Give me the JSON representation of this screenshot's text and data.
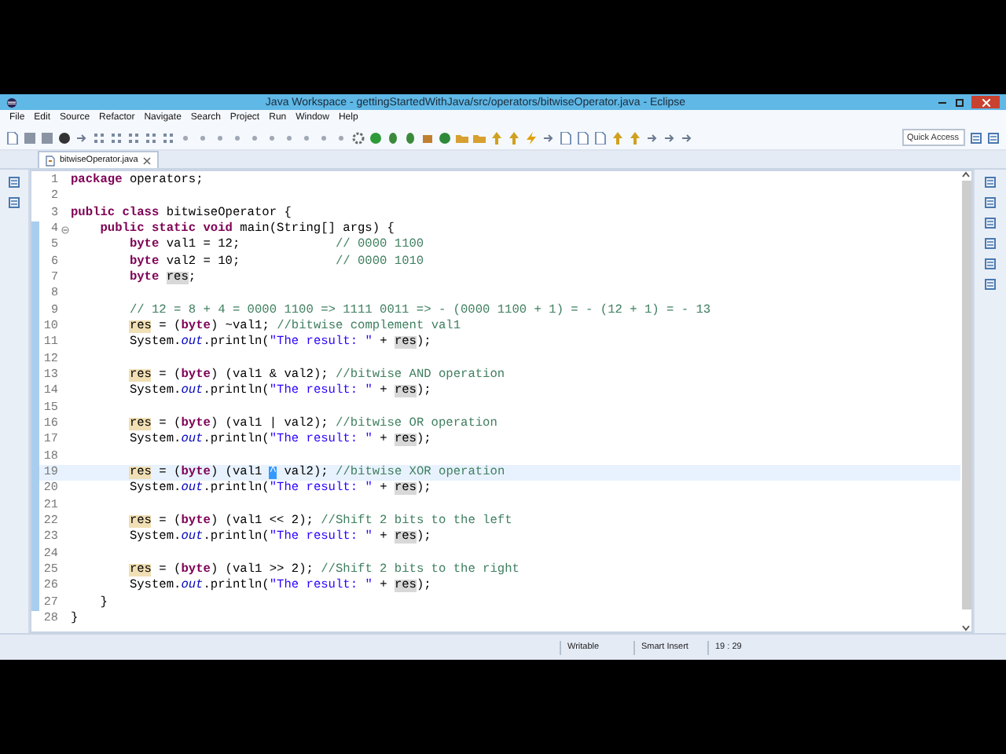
{
  "window": {
    "title": "Java Workspace - gettingStartedWithJava/src/operators/bitwiseOperator.java - Eclipse"
  },
  "menu": [
    "File",
    "Edit",
    "Source",
    "Refactor",
    "Navigate",
    "Search",
    "Project",
    "Run",
    "Window",
    "Help"
  ],
  "toolbar": {
    "quick_access": {
      "placeholder": "Quick Access"
    }
  },
  "editor_tabs": [
    {
      "label": "bitwiseOperator.java",
      "selected": true
    }
  ],
  "editor": {
    "lines": [
      {
        "number": "1",
        "current": false,
        "fold": false,
        "scope": false,
        "tokens": [
          {
            "kind": "keyword",
            "text": "package"
          },
          {
            "kind": "plain",
            "text": " operators;"
          }
        ]
      },
      {
        "number": "2",
        "current": false,
        "fold": false,
        "scope": false
      },
      {
        "number": "3",
        "current": false,
        "fold": false,
        "scope": false,
        "tokens": [
          {
            "kind": "keyword",
            "text": "public class"
          },
          {
            "kind": "plain",
            "text": " bitwiseOperator {"
          }
        ]
      },
      {
        "number": "4",
        "current": false,
        "fold": true,
        "scope": true,
        "tokens": [
          {
            "kind": "keyword",
            "text": "    public static void"
          },
          {
            "kind": "plain",
            "text": " main(String[] args) {"
          }
        ]
      },
      {
        "number": "5",
        "current": false,
        "fold": false,
        "scope": true,
        "tokens": [
          {
            "kind": "keyword",
            "text": "        byte"
          },
          {
            "kind": "plain",
            "text": " val1 = 12;             "
          },
          {
            "kind": "comment",
            "text": "// 0000 1100"
          }
        ]
      },
      {
        "number": "6",
        "current": false,
        "fold": false,
        "scope": true,
        "tokens": [
          {
            "kind": "keyword",
            "text": "        byte"
          },
          {
            "kind": "plain",
            "text": " val2 = 10;             "
          },
          {
            "kind": "comment",
            "text": "// 0000 1010"
          }
        ]
      },
      {
        "number": "7",
        "current": false,
        "fold": false,
        "scope": true,
        "tokens": [
          {
            "kind": "keyword",
            "text": "        byte "
          },
          {
            "kind": "read",
            "text": "res"
          },
          {
            "kind": "plain",
            "text": ";"
          }
        ]
      },
      {
        "number": "8",
        "current": false,
        "fold": false,
        "scope": true
      },
      {
        "number": "9",
        "current": false,
        "fold": false,
        "scope": true,
        "tokens": [
          {
            "kind": "comment",
            "text": "        // 12 = 8 + 4 = 0000 1100 => 1111 0011 => - (0000 1100 + 1) = - (12 + 1) = - 13"
          }
        ]
      },
      {
        "number": "10",
        "current": false,
        "fold": false,
        "scope": true,
        "tokens": [
          {
            "kind": "write",
            "text": "        res"
          },
          {
            "kind": "plain",
            "text": " = ("
          },
          {
            "kind": "keyword",
            "text": "byte"
          },
          {
            "kind": "plain",
            "text": ") ~val1; "
          },
          {
            "kind": "comment",
            "text": "//bitwise complement val1"
          }
        ]
      },
      {
        "number": "11",
        "current": false,
        "fold": false,
        "scope": true,
        "tokens": [
          {
            "kind": "plain",
            "text": "        System."
          },
          {
            "kind": "field",
            "text": "out"
          },
          {
            "kind": "plain",
            "text": ".println("
          },
          {
            "kind": "string",
            "text": "\"The result: \""
          },
          {
            "kind": "plain",
            "text": " + "
          },
          {
            "kind": "read",
            "text": "res"
          },
          {
            "kind": "plain",
            "text": ");"
          }
        ]
      },
      {
        "number": "12",
        "current": false,
        "fold": false,
        "scope": true
      },
      {
        "number": "13",
        "current": false,
        "fold": false,
        "scope": true,
        "tokens": [
          {
            "kind": "write",
            "text": "        res"
          },
          {
            "kind": "plain",
            "text": " = ("
          },
          {
            "kind": "keyword",
            "text": "byte"
          },
          {
            "kind": "plain",
            "text": ") (val1 & val2); "
          },
          {
            "kind": "comment",
            "text": "//bitwise AND operation"
          }
        ]
      },
      {
        "number": "14",
        "current": false,
        "fold": false,
        "scope": true,
        "tokens": [
          {
            "kind": "plain",
            "text": "        System."
          },
          {
            "kind": "field",
            "text": "out"
          },
          {
            "kind": "plain",
            "text": ".println("
          },
          {
            "kind": "string",
            "text": "\"The result: \""
          },
          {
            "kind": "plain",
            "text": " + "
          },
          {
            "kind": "read",
            "text": "res"
          },
          {
            "kind": "plain",
            "text": ");"
          }
        ]
      },
      {
        "number": "15",
        "current": false,
        "fold": false,
        "scope": true
      },
      {
        "number": "16",
        "current": false,
        "fold": false,
        "scope": true,
        "tokens": [
          {
            "kind": "write",
            "text": "        res"
          },
          {
            "kind": "plain",
            "text": " = ("
          },
          {
            "kind": "keyword",
            "text": "byte"
          },
          {
            "kind": "plain",
            "text": ") (val1 | val2); "
          },
          {
            "kind": "comment",
            "text": "//bitwise OR operation"
          }
        ]
      },
      {
        "number": "17",
        "current": false,
        "fold": false,
        "scope": true,
        "tokens": [
          {
            "kind": "plain",
            "text": "        System."
          },
          {
            "kind": "field",
            "text": "out"
          },
          {
            "kind": "plain",
            "text": ".println("
          },
          {
            "kind": "string",
            "text": "\"The result: \""
          },
          {
            "kind": "plain",
            "text": " + "
          },
          {
            "kind": "read",
            "text": "res"
          },
          {
            "kind": "plain",
            "text": ");"
          }
        ]
      },
      {
        "number": "18",
        "current": false,
        "fold": false,
        "scope": true
      },
      {
        "number": "19",
        "current": true,
        "fold": false,
        "scope": true,
        "tokens": [
          {
            "kind": "write",
            "text": "        res"
          },
          {
            "kind": "plain",
            "text": " = ("
          },
          {
            "kind": "keyword",
            "text": "byte"
          },
          {
            "kind": "plain",
            "text": ") (val1 "
          },
          {
            "kind": "selected",
            "text": "^"
          },
          {
            "kind": "plain",
            "text": " val2); "
          },
          {
            "kind": "comment",
            "text": "//bitwise XOR operation"
          }
        ]
      },
      {
        "number": "20",
        "current": false,
        "fold": false,
        "scope": true,
        "tokens": [
          {
            "kind": "plain",
            "text": "        System."
          },
          {
            "kind": "field",
            "text": "out"
          },
          {
            "kind": "plain",
            "text": ".println("
          },
          {
            "kind": "string",
            "text": "\"The result: \""
          },
          {
            "kind": "plain",
            "text": " + "
          },
          {
            "kind": "read",
            "text": "res"
          },
          {
            "kind": "plain",
            "text": ");"
          }
        ]
      },
      {
        "number": "21",
        "current": false,
        "fold": false,
        "scope": true
      },
      {
        "number": "22",
        "current": false,
        "fold": false,
        "scope": true,
        "tokens": [
          {
            "kind": "write",
            "text": "        res"
          },
          {
            "kind": "plain",
            "text": " = ("
          },
          {
            "kind": "keyword",
            "text": "byte"
          },
          {
            "kind": "plain",
            "text": ") (val1 << 2); "
          },
          {
            "kind": "comment",
            "text": "//Shift 2 bits to the left"
          }
        ]
      },
      {
        "number": "23",
        "current": false,
        "fold": false,
        "scope": true,
        "tokens": [
          {
            "kind": "plain",
            "text": "        System."
          },
          {
            "kind": "field",
            "text": "out"
          },
          {
            "kind": "plain",
            "text": ".println("
          },
          {
            "kind": "string",
            "text": "\"The result: \""
          },
          {
            "kind": "plain",
            "text": " + "
          },
          {
            "kind": "read",
            "text": "res"
          },
          {
            "kind": "plain",
            "text": ");"
          }
        ]
      },
      {
        "number": "24",
        "current": false,
        "fold": false,
        "scope": true
      },
      {
        "number": "25",
        "current": false,
        "fold": false,
        "scope": true,
        "tokens": [
          {
            "kind": "write",
            "text": "        res"
          },
          {
            "kind": "plain",
            "text": " = ("
          },
          {
            "kind": "keyword",
            "text": "byte"
          },
          {
            "kind": "plain",
            "text": ") (val1 >> 2); "
          },
          {
            "kind": "comment",
            "text": "//Shift 2 bits to the right"
          }
        ]
      },
      {
        "number": "26",
        "current": false,
        "fold": false,
        "scope": true,
        "tokens": [
          {
            "kind": "plain",
            "text": "        System."
          },
          {
            "kind": "field",
            "text": "out"
          },
          {
            "kind": "plain",
            "text": ".println("
          },
          {
            "kind": "string",
            "text": "\"The result: \""
          },
          {
            "kind": "plain",
            "text": " + "
          },
          {
            "kind": "read",
            "text": "res"
          },
          {
            "kind": "plain",
            "text": ");"
          }
        ]
      },
      {
        "number": "27",
        "current": false,
        "fold": false,
        "scope": true,
        "tokens": [
          {
            "kind": "plain",
            "text": "    }"
          }
        ]
      },
      {
        "number": "28",
        "current": false,
        "fold": false,
        "scope": false,
        "tokens": [
          {
            "kind": "plain",
            "text": "}"
          }
        ]
      }
    ]
  },
  "status_bar": {
    "mode": "Writable",
    "insert_mode": "Smart Insert",
    "position": "19 : 29"
  }
}
